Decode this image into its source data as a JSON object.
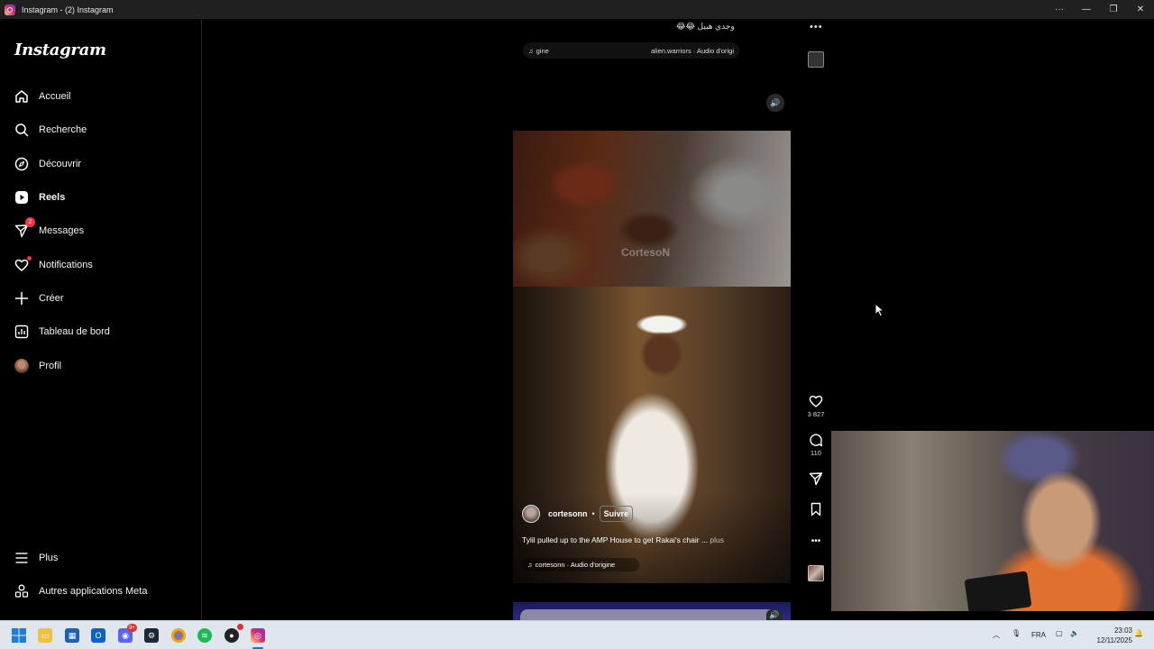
{
  "window": {
    "title": "Instagram - (2) Instagram"
  },
  "sidebar": {
    "logo": "Instagram",
    "items": [
      {
        "label": "Accueil",
        "icon": "home-icon"
      },
      {
        "label": "Recherche",
        "icon": "search-icon"
      },
      {
        "label": "Découvrir",
        "icon": "compass-icon"
      },
      {
        "label": "Reels",
        "icon": "reels-icon",
        "active": true
      },
      {
        "label": "Messages",
        "icon": "messenger-icon",
        "badge": "2"
      },
      {
        "label": "Notifications",
        "icon": "heart-icon"
      },
      {
        "label": "Créer",
        "icon": "plus-icon"
      },
      {
        "label": "Tableau de bord",
        "icon": "dashboard-icon"
      },
      {
        "label": "Profil",
        "icon": "avatar"
      }
    ],
    "bottom_items": [
      {
        "label": "Plus",
        "icon": "menu-icon"
      },
      {
        "label": "Autres applications Meta",
        "icon": "meta-apps-icon"
      }
    ]
  },
  "previous_reel": {
    "caption": "وجدي هبيل 😂😂",
    "audio_left": "gine",
    "audio_right": "alien.warriors · Audio d'origi"
  },
  "current_reel": {
    "watermark": "CortesoN",
    "author": "cortesonn",
    "separator": "•",
    "follow_label": "Suivre",
    "caption": "Tylil pulled up to the AMP House to get Rakai's chair ...",
    "caption_more": "plus",
    "audio": "cortesonn · Audio d'origine",
    "likes": "3 827",
    "comments": "110"
  },
  "taskbar": {
    "language": "FRA",
    "time": "23:03",
    "date": "12/11/2025",
    "discord_badge": "9+"
  },
  "colors": {
    "notification_red": "#ff3040",
    "background": "#000000",
    "taskbar": "#dfe6ee"
  }
}
